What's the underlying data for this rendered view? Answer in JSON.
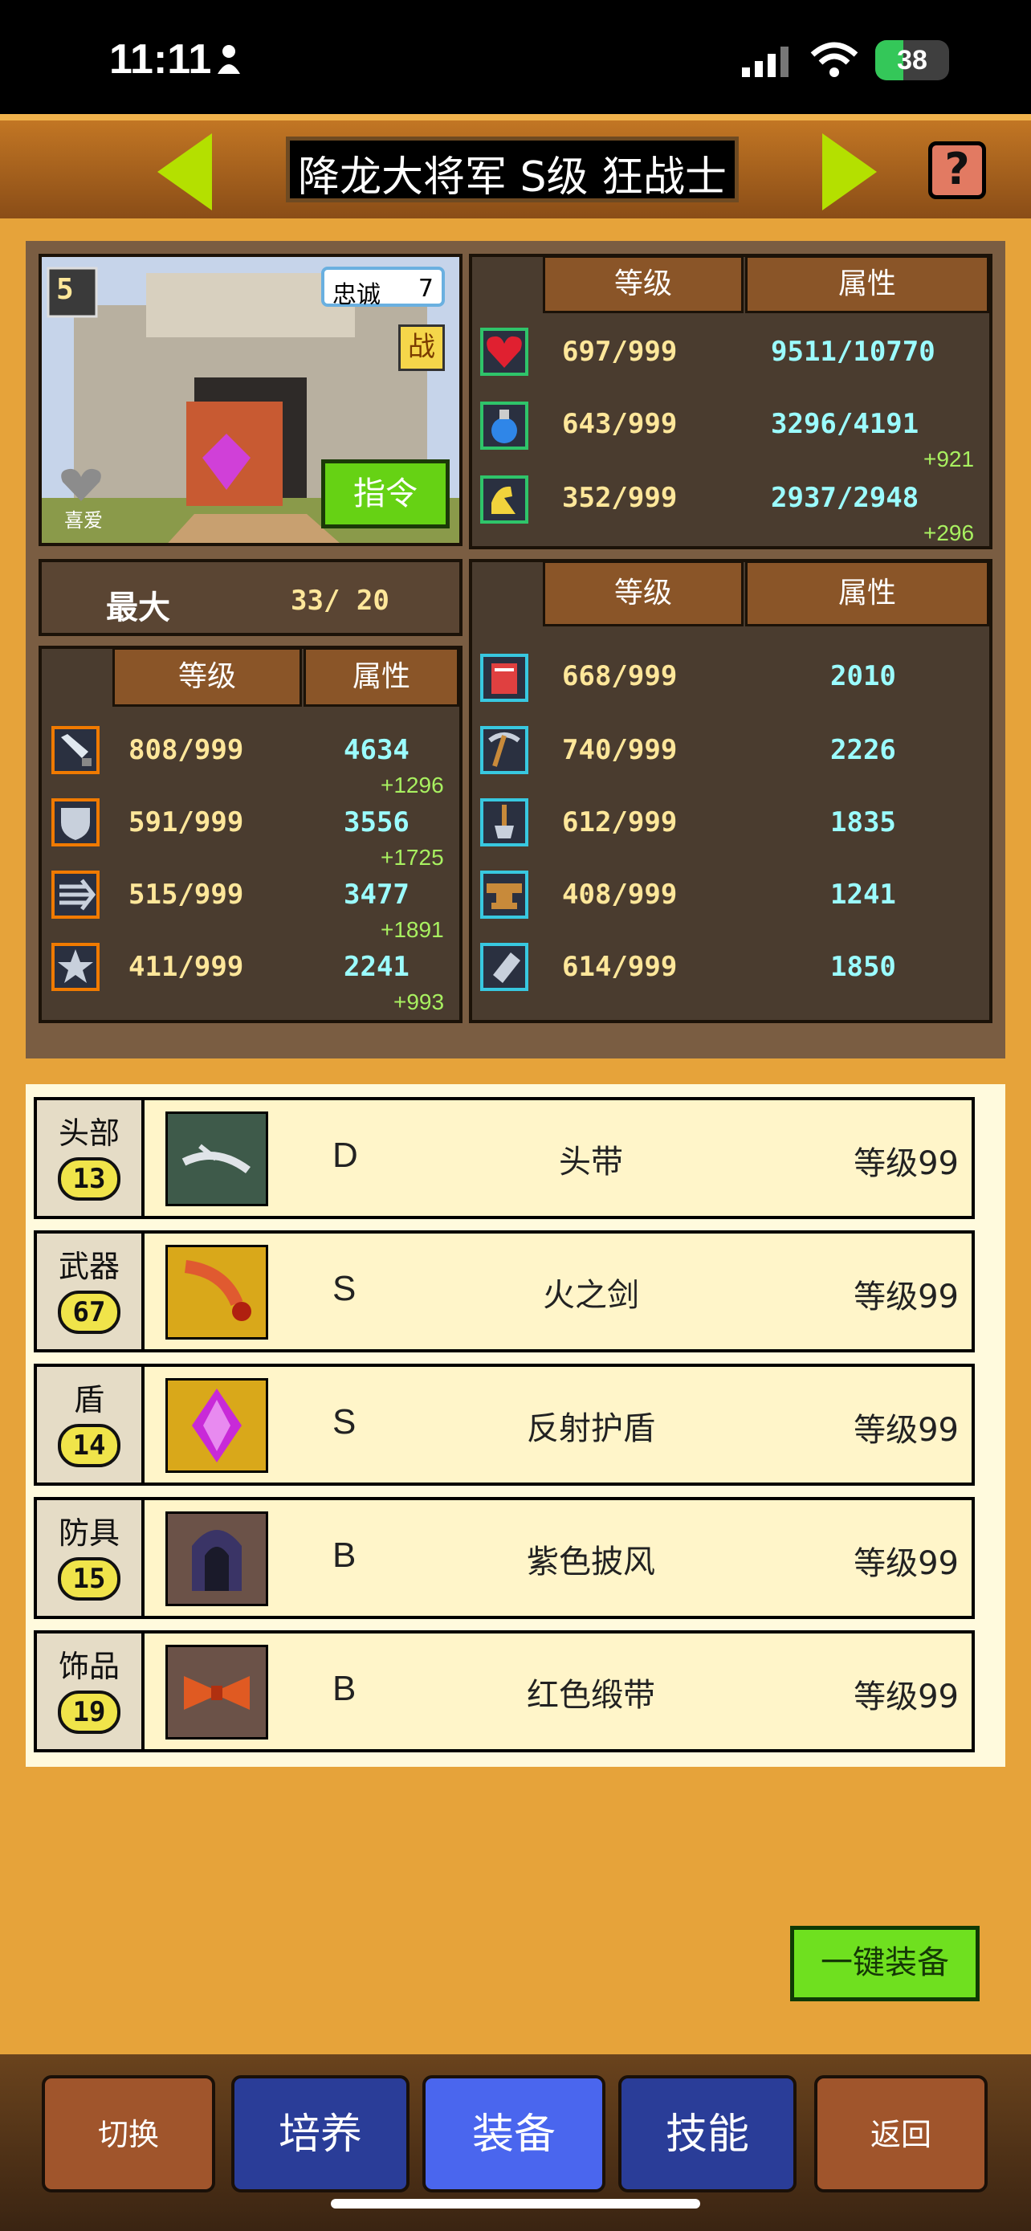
{
  "status_bar": {
    "time": "11:11",
    "battery": 38
  },
  "header": {
    "title": "降龙大将军 S级 狂战士"
  },
  "portrait": {
    "loyalty_label": "忠诚",
    "loyalty_value": "7",
    "level_badge": "5",
    "battle_badge": "战",
    "favorite_label": "喜爱",
    "command_button": "指令"
  },
  "top_stats": {
    "headers": [
      "等级",
      "属性"
    ],
    "rows": [
      {
        "icon": "heart-icon",
        "level": "697/999",
        "value": "9511/10770",
        "bonus": ""
      },
      {
        "icon": "potion-icon",
        "level": "643/999",
        "value": "3296/4191",
        "bonus": "+921"
      },
      {
        "icon": "stamina-icon",
        "level": "352/999",
        "value": "2937/2948",
        "bonus": "+296"
      }
    ]
  },
  "grade": {
    "label": "最大",
    "value": "33/ 20"
  },
  "combat_stats": {
    "headers": [
      "等级",
      "属性"
    ],
    "rows": [
      {
        "icon": "sword-icon",
        "level": "808/999",
        "value": "4634",
        "bonus": "+1296"
      },
      {
        "icon": "shield-icon",
        "level": "591/999",
        "value": "3556",
        "bonus": "+1725"
      },
      {
        "icon": "speed-icon",
        "level": "515/999",
        "value": "3477",
        "bonus": "+1891"
      },
      {
        "icon": "star-icon",
        "level": "411/999",
        "value": "2241",
        "bonus": "+993"
      }
    ]
  },
  "skill_stats": {
    "headers": [
      "等级",
      "属性"
    ],
    "rows": [
      {
        "icon": "book-icon",
        "level": "668/999",
        "value": "2010"
      },
      {
        "icon": "pickaxe-icon",
        "level": "740/999",
        "value": "2226"
      },
      {
        "icon": "shovel-icon",
        "level": "612/999",
        "value": "1835"
      },
      {
        "icon": "anvil-icon",
        "level": "408/999",
        "value": "1241"
      },
      {
        "icon": "crystal-icon",
        "level": "614/999",
        "value": "1850"
      }
    ]
  },
  "equipment": [
    {
      "slot": "头部",
      "slot_level": "13",
      "grade": "D",
      "name": "头带",
      "level": "等级99",
      "color": "#3e5a4a"
    },
    {
      "slot": "武器",
      "slot_level": "67",
      "grade": "S",
      "name": "火之剑",
      "level": "等级99",
      "color": "#d9a81a"
    },
    {
      "slot": "盾",
      "slot_level": "14",
      "grade": "S",
      "name": "反射护盾",
      "level": "等级99",
      "color": "#d9a81a"
    },
    {
      "slot": "防具",
      "slot_level": "15",
      "grade": "B",
      "name": "紫色披风",
      "level": "等级99",
      "color": "#6b5248"
    },
    {
      "slot": "饰品",
      "slot_level": "19",
      "grade": "B",
      "name": "红色缎带",
      "level": "等级99",
      "color": "#6b5248"
    }
  ],
  "auto_equip_button": "一键装备",
  "bottom_nav": [
    "切换",
    "培养",
    "装备",
    "技能",
    "返回"
  ]
}
